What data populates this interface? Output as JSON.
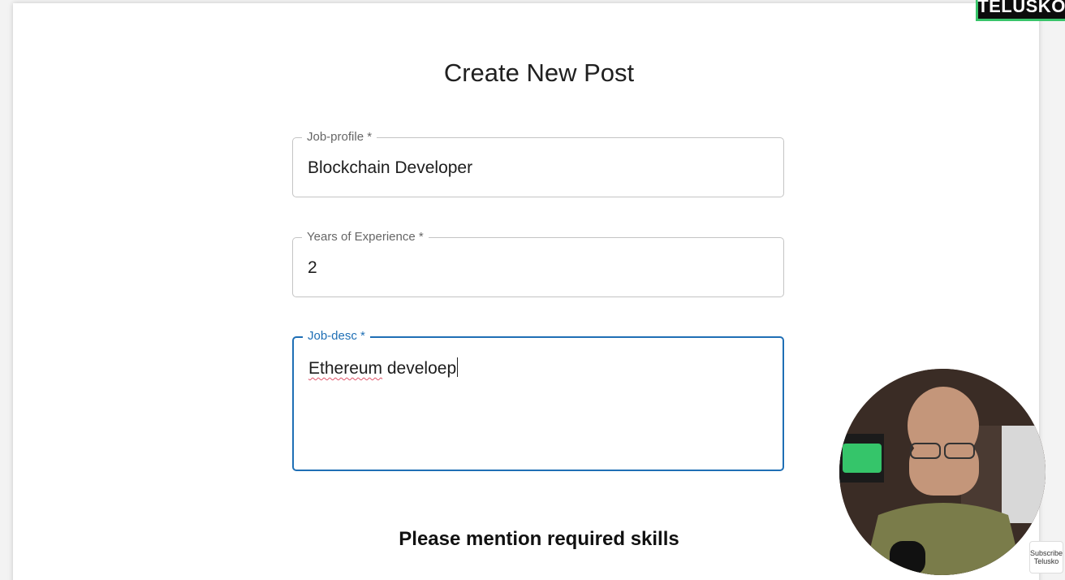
{
  "brand": {
    "label": "TELUSKO",
    "accent_color": "#39c46a"
  },
  "form": {
    "title": "Create New Post",
    "fields": [
      {
        "label": "Job-profile *",
        "value": "Blockchain Developer",
        "focused": false
      },
      {
        "label": "Years of Experience *",
        "value": "2",
        "focused": false
      },
      {
        "label": "Job-desc *",
        "value_word1": "Ethereum",
        "value_rest": " develoep",
        "focused": true
      }
    ],
    "skills_heading": "Please mention required skills",
    "first_skill_label": ""
  },
  "colors": {
    "focus_border": "#1f6fb5",
    "field_border": "#c4c4c4",
    "spell_underline": "#e0556a"
  },
  "overlay": {
    "subscribe_line1": "Subscribe",
    "subscribe_line2": "Telusko"
  }
}
